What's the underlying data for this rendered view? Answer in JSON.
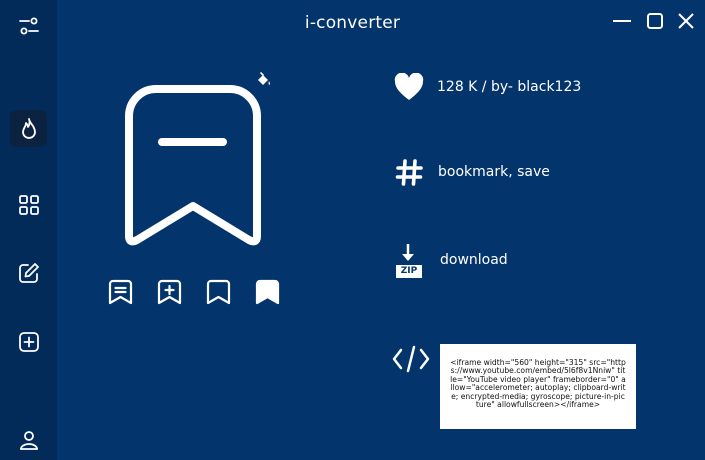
{
  "app": {
    "title": "i-converter"
  },
  "window_controls": [
    "minimize-icon",
    "maximize-icon",
    "close-icon"
  ],
  "sidebar": {
    "items": [
      {
        "name": "settings-sliders-icon",
        "active": false
      },
      {
        "name": "fire-icon",
        "active": true
      },
      {
        "name": "grid-icon",
        "active": false
      },
      {
        "name": "edit-icon",
        "active": false
      },
      {
        "name": "add-icon",
        "active": false
      },
      {
        "name": "user-icon",
        "active": false
      }
    ]
  },
  "preview": {
    "icon": "bookmark-minus-icon",
    "color_picker_icon": "paint-bucket-icon",
    "variants": [
      "bookmark-lines-icon",
      "bookmark-plus-icon",
      "bookmark-outline-icon",
      "bookmark-filled-icon"
    ]
  },
  "info": {
    "likes": "128 K / by- black123",
    "tags": "bookmark, save",
    "download": "download",
    "zip_label": "ZIP",
    "embed_code": "<iframe width=\"560\" height=\"315\" src=\"https://www.youtube.com/embed/5l6f8v1Nniw\" title=\"YouTube video player\" frameborder=\"0\" allow=\"accelerometer; autoplay; clipboard-write; encrypted-media; gyroscope; picture-in-picture\" allowfullscreen></iframe>"
  },
  "colors": {
    "background": "#03346b",
    "sidebar": "#022b5a",
    "active_item": "#0b2240",
    "foreground": "#ffffff"
  }
}
